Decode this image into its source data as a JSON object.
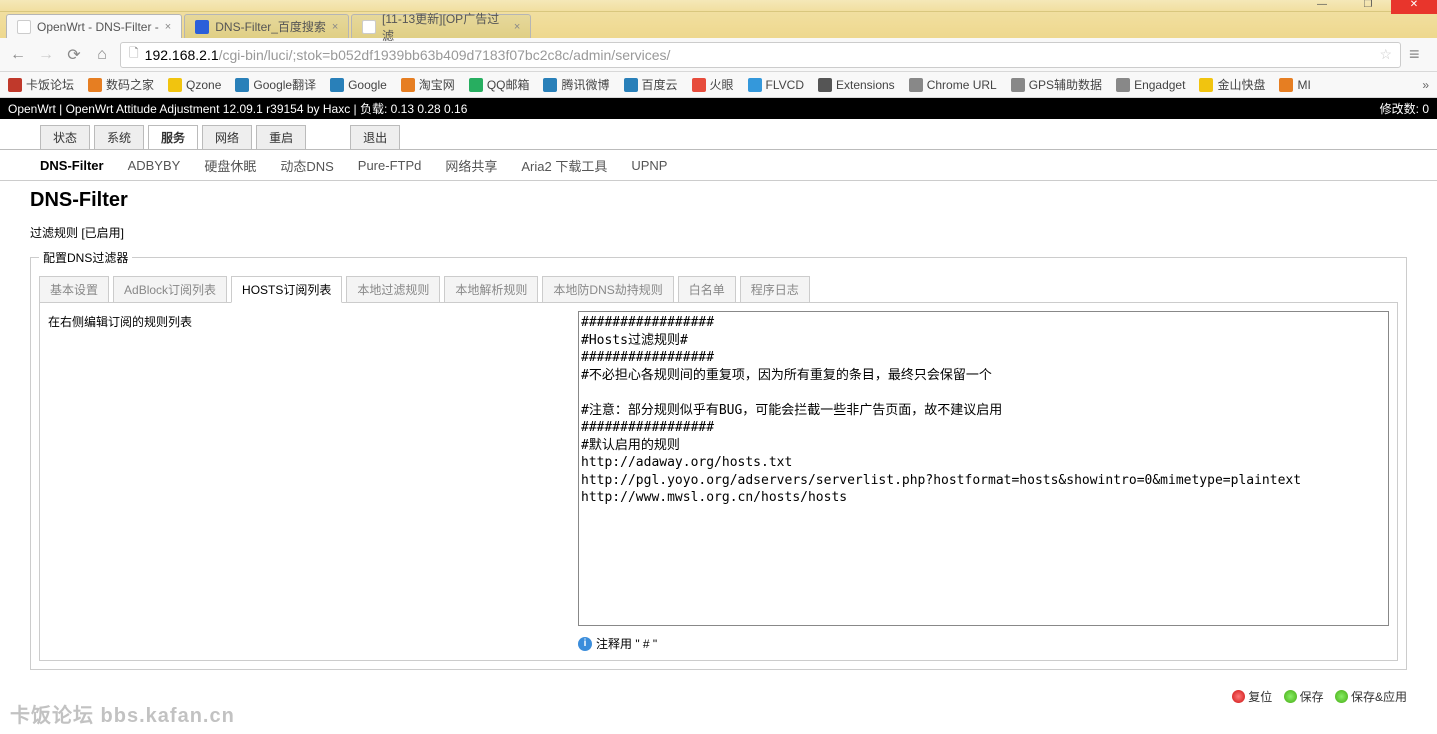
{
  "window": {
    "tabs": [
      {
        "title": "OpenWrt - DNS-Filter -",
        "active": true
      },
      {
        "title": "DNS-Filter_百度搜索",
        "active": false
      },
      {
        "title": "[11-13更新][OP广告过滤",
        "active": false
      }
    ],
    "url_ip": "192.168.2.1",
    "url_path": "/cgi-bin/luci/;stok=b052df1939bb63b409d7183f07bc2c8c/admin/services/"
  },
  "bookmarks": [
    "卡饭论坛",
    "数码之家",
    "Qzone",
    "Google翻译",
    "Google",
    "淘宝网",
    "QQ邮箱",
    "腾讯微博",
    "百度云",
    "火眼",
    "FLVCD",
    "Extensions",
    "Chrome URL",
    "GPS辅助数据",
    "Engadget",
    "金山快盘",
    "MI"
  ],
  "bookmark_colors": [
    "#c0392b",
    "#e67e22",
    "#f1c40f",
    "#2980b9",
    "#2980b9",
    "#e67e22",
    "#27ae60",
    "#2980b9",
    "#2980b9",
    "#e74c3c",
    "#3498db",
    "#555",
    "#888",
    "#888",
    "#888",
    "#f1c40f",
    "#e67e22"
  ],
  "owrt": {
    "left": "OpenWrt | OpenWrt Attitude Adjustment 12.09.1 r39154 by Haxc | 负载: 0.13 0.28 0.16",
    "right": "修改数: 0"
  },
  "main_nav": [
    "状态",
    "系统",
    "服务",
    "网络",
    "重启"
  ],
  "main_nav_active": 2,
  "main_nav_extra": "退出",
  "sub_nav": [
    "DNS-Filter",
    "ADBYBY",
    "硬盘休眠",
    "动态DNS",
    "Pure-FTPd",
    "网络共享",
    "Aria2 下载工具",
    "UPNP"
  ],
  "sub_nav_active": 0,
  "page": {
    "title": "DNS-Filter",
    "status": "过滤规则 [已启用]",
    "fieldset_legend": "配置DNS过滤器",
    "cfg_tabs": [
      "基本设置",
      "AdBlock订阅列表",
      "HOSTS订阅列表",
      "本地过滤规则",
      "本地解析规则",
      "本地防DNS劫持规则",
      "白名单",
      "程序日志"
    ],
    "cfg_tab_active": 2,
    "left_desc": "在右侧编辑订阅的规则列表",
    "textarea": "#################\n#Hosts过滤规则#\n#################\n#不必担心各规则间的重复项，因为所有重复的条目，最终只会保留一个\n\n#注意：部分规则似乎有BUG，可能会拦截一些非广告页面，故不建议启用\n#################\n#默认启用的规则\nhttp://adaway.org/hosts.txt\nhttp://pgl.yoyo.org/adservers/serverlist.php?hostformat=hosts&showintro=0&mimetype=plaintext\nhttp://www.mwsl.org.cn/hosts/hosts",
    "hint": "注释用 \" # \"",
    "actions": {
      "reset": "复位",
      "save": "保存",
      "save_apply": "保存&应用"
    }
  },
  "watermark": "卡饭论坛 bbs.kafan.cn"
}
